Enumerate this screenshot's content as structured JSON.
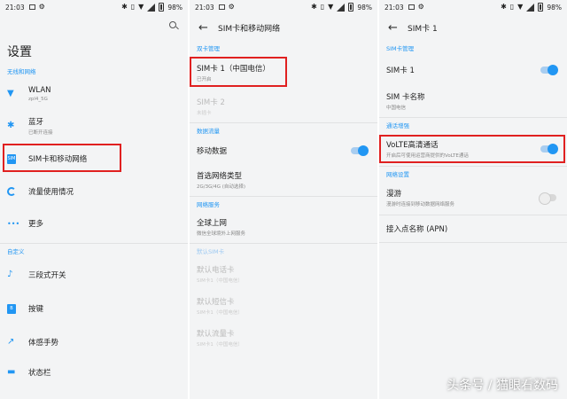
{
  "colors": {
    "accent": "#2196f3",
    "highlight": "#e02020",
    "background": "#f3f4f5"
  },
  "panel1": {
    "status": {
      "time": "21:03",
      "battery": "98%"
    },
    "title": "设置",
    "section_wireless": "无线和网络",
    "wlan": {
      "title": "WLAN",
      "sub": "zpl4_5G"
    },
    "bluetooth": {
      "title": "蓝牙",
      "sub": "已断开连接"
    },
    "sim": {
      "title": "SIM卡和移动网络"
    },
    "data_usage": {
      "title": "流量使用情况"
    },
    "more": {
      "title": "更多"
    },
    "section_custom": "自定义",
    "alert_slider": {
      "title": "三段式开关"
    },
    "buttons": {
      "title": "按键"
    },
    "gestures": {
      "title": "体感手势"
    },
    "last": {
      "title": "状态栏"
    }
  },
  "panel2": {
    "status": {
      "time": "21:03",
      "battery": "98%"
    },
    "title": "SIM卡和移动网络",
    "section_dual": "双卡管理",
    "sim1": {
      "title": "SIM卡 1（中国电信）",
      "sub": "已开启"
    },
    "sim2": {
      "title": "SIM卡 2",
      "sub": "未插卡"
    },
    "section_data": "数据流量",
    "mobile_data": {
      "title": "移动数据"
    },
    "network_type": {
      "title": "首选网络类型",
      "sub": "2G/3G/4G (自动选择)"
    },
    "section_network": "网络服务",
    "global": {
      "title": "全球上网",
      "sub": "微信全球境外上网服务"
    },
    "section_default": "默认SIM卡",
    "default_call": {
      "title": "默认电话卡",
      "sub": "SIM卡1（中国电信）"
    },
    "default_sms": {
      "title": "默认短信卡",
      "sub": "SIM卡1（中国电信）"
    },
    "default_data": {
      "title": "默认流量卡",
      "sub": "SIM卡1（中国电信）"
    }
  },
  "panel3": {
    "status": {
      "time": "21:03",
      "battery": "98%"
    },
    "title": "SIM卡 1",
    "section_sim": "SIM卡管理",
    "sim1": {
      "title": "SIM卡 1"
    },
    "sim_name": {
      "title": "SIM 卡名称",
      "sub": "中国电信"
    },
    "section_call": "通话增强",
    "volte": {
      "title": "VoLTE高清通话",
      "sub": "开启后可使用运营商提供的VoLTE通话"
    },
    "section_network": "网络设置",
    "roaming": {
      "title": "漫游",
      "sub": "漫游时连接到移动数据网络服务"
    },
    "apn": {
      "title": "接入点名称 (APN)"
    }
  },
  "watermark": "头条号 / 猫眼看数码"
}
